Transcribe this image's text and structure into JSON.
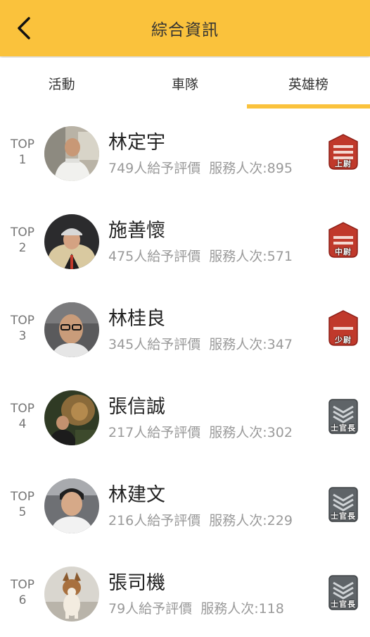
{
  "header": {
    "title": "綜合資訊"
  },
  "tabs": [
    {
      "label": "活動"
    },
    {
      "label": "車隊"
    },
    {
      "label": "英雄榜"
    }
  ],
  "colors": {
    "accent": "#fac23c",
    "officer_badge": "#c0392b",
    "nco_badge": "#5f6468"
  },
  "ranking": [
    {
      "rank_top": "TOP",
      "rank_num": "1",
      "name": "林定宇",
      "ratings": "749人給予評價",
      "services": "服務人次:895",
      "badge": "上尉",
      "badge_type": "officer",
      "avatar_icon": "man-white-shirt-avatar"
    },
    {
      "rank_top": "TOP",
      "rank_num": "2",
      "name": "施善懷",
      "ratings": "475人給予評價",
      "services": "服務人次:571",
      "badge": "中尉",
      "badge_type": "officer",
      "avatar_icon": "man-cap-avatar"
    },
    {
      "rank_top": "TOP",
      "rank_num": "3",
      "name": "林桂良",
      "ratings": "345人給予評價",
      "services": "服務人次:347",
      "badge": "少尉",
      "badge_type": "officer",
      "avatar_icon": "man-glasses-avatar"
    },
    {
      "rank_top": "TOP",
      "rank_num": "4",
      "name": "張信誠",
      "ratings": "217人給予評價",
      "services": "服務人次:302",
      "badge": "士官長",
      "badge_type": "nco",
      "avatar_icon": "man-lion-avatar"
    },
    {
      "rank_top": "TOP",
      "rank_num": "5",
      "name": "林建文",
      "ratings": "216人給予評價",
      "services": "服務人次:229",
      "badge": "士官長",
      "badge_type": "nco",
      "avatar_icon": "man-car-avatar"
    },
    {
      "rank_top": "TOP",
      "rank_num": "6",
      "name": "張司機",
      "ratings": "79人給予評價",
      "services": "服務人次:118",
      "badge": "士官長",
      "badge_type": "nco",
      "avatar_icon": "dog-avatar"
    }
  ]
}
